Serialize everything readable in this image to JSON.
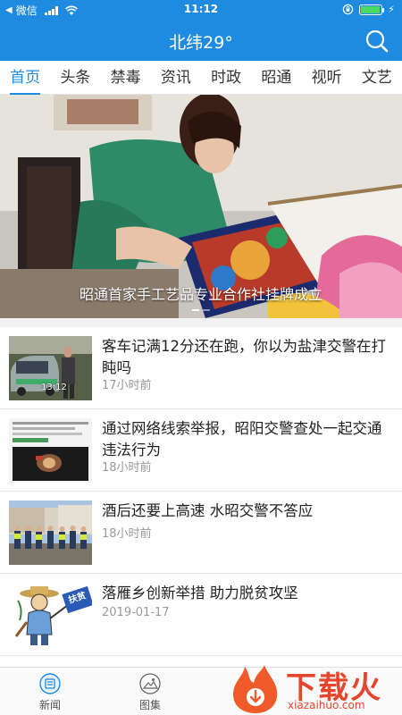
{
  "status_bar": {
    "carrier": "微信",
    "time": "11:12",
    "battery_level": 0.95
  },
  "header": {
    "title": "北纬29°"
  },
  "tabs": [
    {
      "label": "首页",
      "active": true
    },
    {
      "label": "头条",
      "active": false
    },
    {
      "label": "禁毒",
      "active": false
    },
    {
      "label": "资讯",
      "active": false
    },
    {
      "label": "时政",
      "active": false
    },
    {
      "label": "昭通",
      "active": false
    },
    {
      "label": "视听",
      "active": false
    },
    {
      "label": "文艺",
      "active": false
    }
  ],
  "banner": {
    "caption": "昭通首家手工艺品专业合作社挂牌成立",
    "slide_count": 2,
    "current_slide": 1
  },
  "news": [
    {
      "title": "客车记满12分还在跑，你以为盐津交警在打盹吗",
      "time": "17小时前",
      "thumb_overlay": "13:12"
    },
    {
      "title": "通过网络线索举报，昭阳交警查处一起交通违法行为",
      "time": "18小时前"
    },
    {
      "title": "酒后还要上高速 水昭交警不答应",
      "time": "18小时前"
    },
    {
      "title": "落雁乡创新举措 助力脱贫攻坚",
      "time": "2019-01-17",
      "thumb_overlay": "扶贫"
    }
  ],
  "bottom_nav": [
    {
      "label": "新闻",
      "icon": "newspaper-icon"
    },
    {
      "label": "图集",
      "icon": "gallery-icon"
    }
  ],
  "watermark": {
    "text": "下载火",
    "url": "xiazaihuo.com"
  },
  "colors": {
    "primary": "#1e8ae0",
    "watermark": "#e8442c"
  }
}
